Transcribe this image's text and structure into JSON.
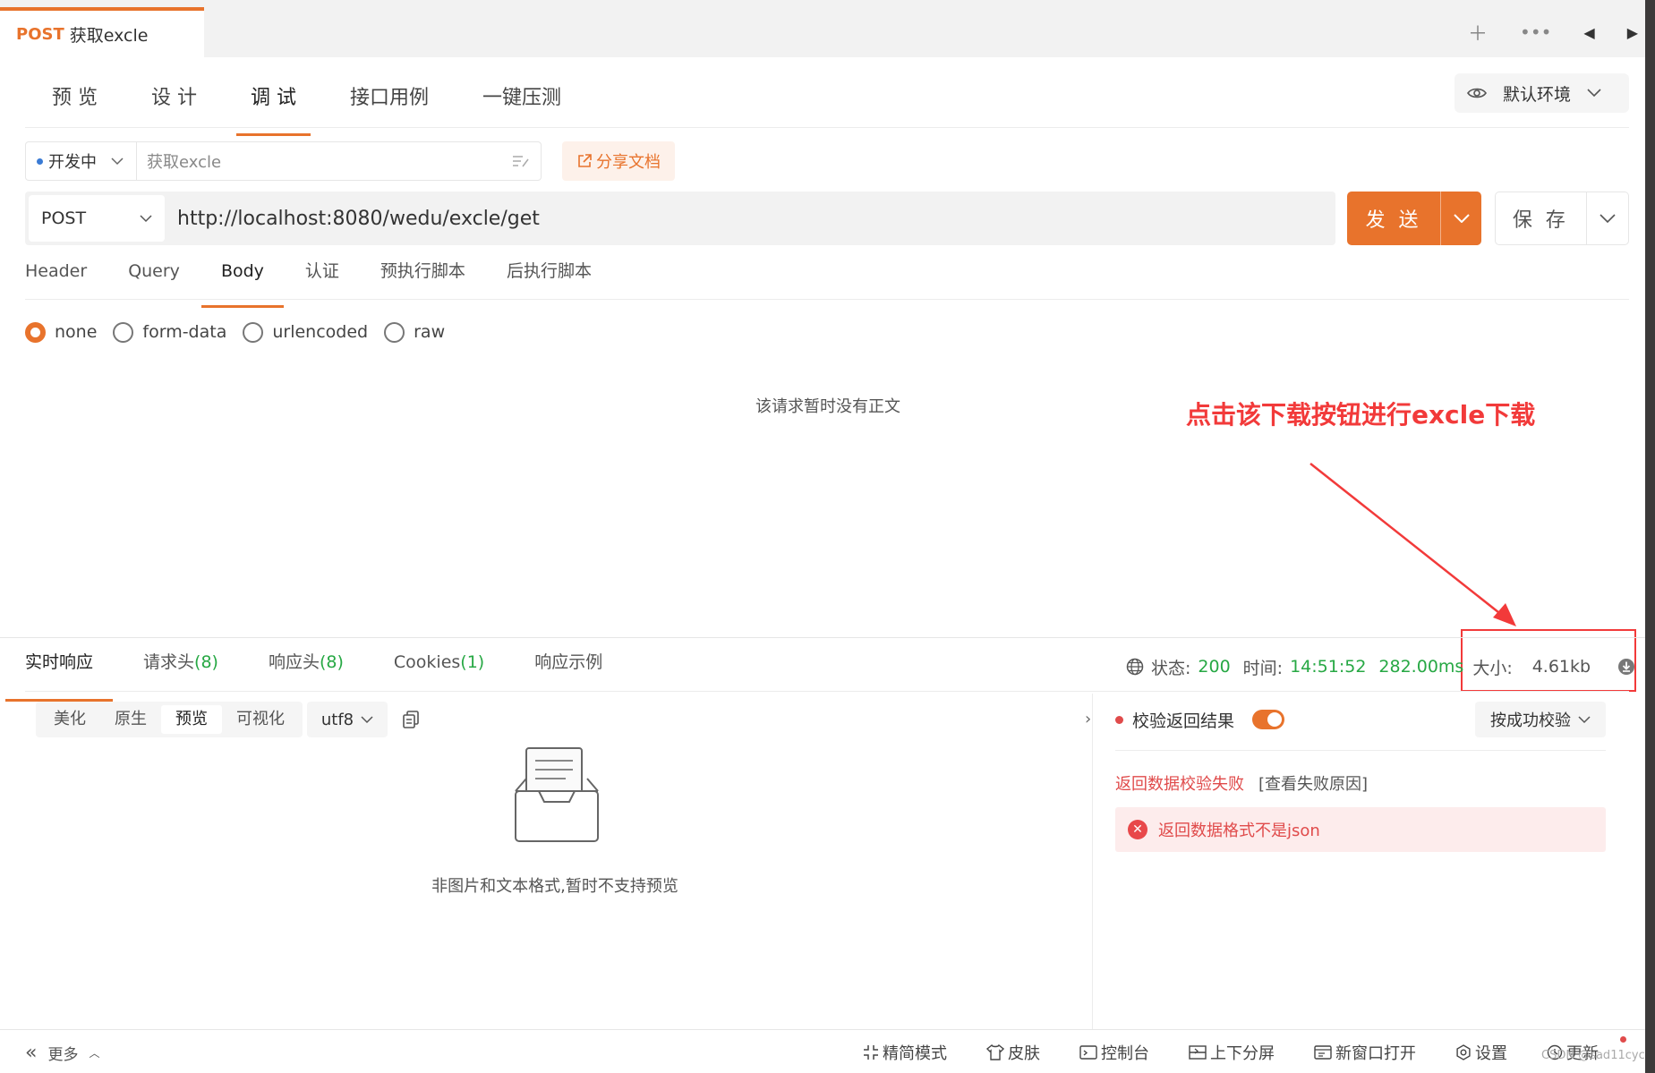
{
  "doc_tab": {
    "method": "POST",
    "name": "获取excle"
  },
  "nav": {
    "tabs": [
      "预 览",
      "设 计",
      "调 试",
      "接口用例",
      "一键压测"
    ],
    "active": 2,
    "env": "默认环境"
  },
  "request": {
    "status": "开发中",
    "name": "获取excle",
    "share": "分享文档",
    "method": "POST",
    "url": "http://localhost:8080/wedu/excle/get",
    "send": "发 送",
    "save": "保 存",
    "tabs": [
      "Header",
      "Query",
      "Body",
      "认证",
      "预执行脚本",
      "后执行脚本"
    ],
    "body_types": [
      "none",
      "form-data",
      "urlencoded",
      "raw"
    ],
    "empty_body": "该请求暂时没有正文"
  },
  "annotation": "点击该下载按钮进行excle下载",
  "response": {
    "tabs": [
      {
        "label": "实时响应",
        "count": ""
      },
      {
        "label": "请求头",
        "count": "(8)"
      },
      {
        "label": "响应头",
        "count": "(8)"
      },
      {
        "label": "Cookies",
        "count": "(1)"
      },
      {
        "label": "响应示例",
        "count": ""
      }
    ],
    "status_label": "状态:",
    "status_value": "200",
    "time_label": "时间:",
    "time_value": "14:51:52",
    "duration": "282.00ms",
    "size_label": "大小:",
    "size_value": "4.61kb",
    "formats": [
      "美化",
      "原生",
      "预览",
      "可视化"
    ],
    "encoding": "utf8",
    "preview_msg": "非图片和文本格式,暂时不支持预览",
    "verify_label": "校验返回结果",
    "verify_mode": "按成功校验",
    "fail_title": "返回数据校验失败",
    "fail_link": "[查看失败原因]",
    "error_msg": "返回数据格式不是json"
  },
  "footer": {
    "more": "更多",
    "items": [
      "精简模式",
      "皮肤",
      "控制台",
      "上下分屏",
      "新窗口打开",
      "设置",
      "更新"
    ],
    "watermark": "CSDN @sad11cyc"
  },
  "colors": {
    "accent": "#e8732c",
    "success": "#27a844",
    "error": "#e04b4b",
    "annotation": "#f23a3a"
  }
}
